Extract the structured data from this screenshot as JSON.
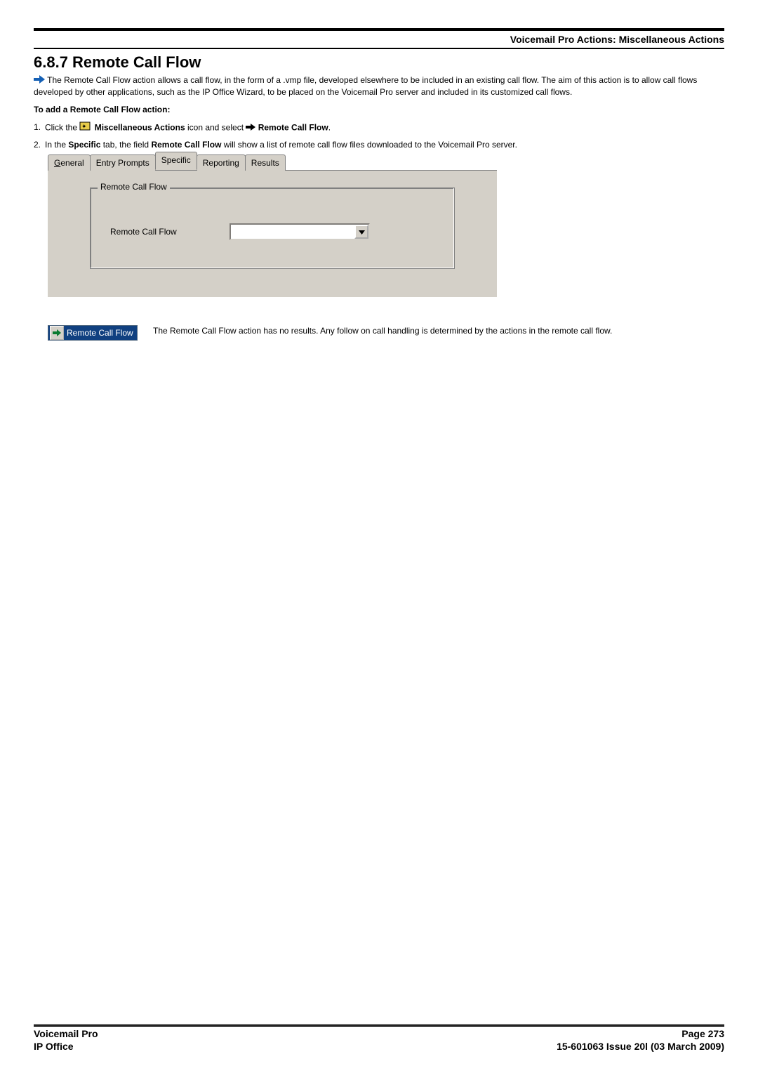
{
  "header": {
    "breadcrumb": "Voicemail Pro Actions: Miscellaneous Actions"
  },
  "section": {
    "title": "6.8.7 Remote Call Flow",
    "intro": " The Remote Call Flow action allows a call flow, in the form of a .vmp file, developed elsewhere to be included in an existing call flow. The aim of this action is to allow call flows developed by other applications, such as the IP Office Wizard, to be placed on the Voicemail Pro server and included in its customized call flows.",
    "sub_bold": "To add a Remote Call Flow action:",
    "step1_prefix": "1.",
    "step1_a": "Click the ",
    "step1_misc": " Miscellaneous Actions",
    "step1_mid": " icon and select ",
    "step1_rcf": " Remote Call Flow",
    "step1_end": ".",
    "step2_prefix": "2.",
    "step2_a": "In the ",
    "step2_specific": "Specific",
    "step2_b": " tab, the field ",
    "step2_rcf": "Remote Call Flow",
    "step2_c": " will show a list of remote call flow files downloaded to the  Voicemail Pro server."
  },
  "ui": {
    "tabs": {
      "general": "General",
      "entry_prompts": "Entry Prompts",
      "specific": "Specific",
      "reporting": "Reporting",
      "results": "Results"
    },
    "groupbox_label": "Remote Call Flow",
    "field_label": "Remote Call Flow",
    "dropdown_value": ""
  },
  "result": {
    "icon_label": "Remote Call Flow",
    "text": "The Remote Call Flow action has no results. Any follow on call handling is determined by the actions in the remote call flow."
  },
  "footer": {
    "left1": "Voicemail Pro",
    "right1": "Page 273",
    "left2": "IP Office",
    "right2": "15-601063 Issue 20l (03 March 2009)"
  }
}
